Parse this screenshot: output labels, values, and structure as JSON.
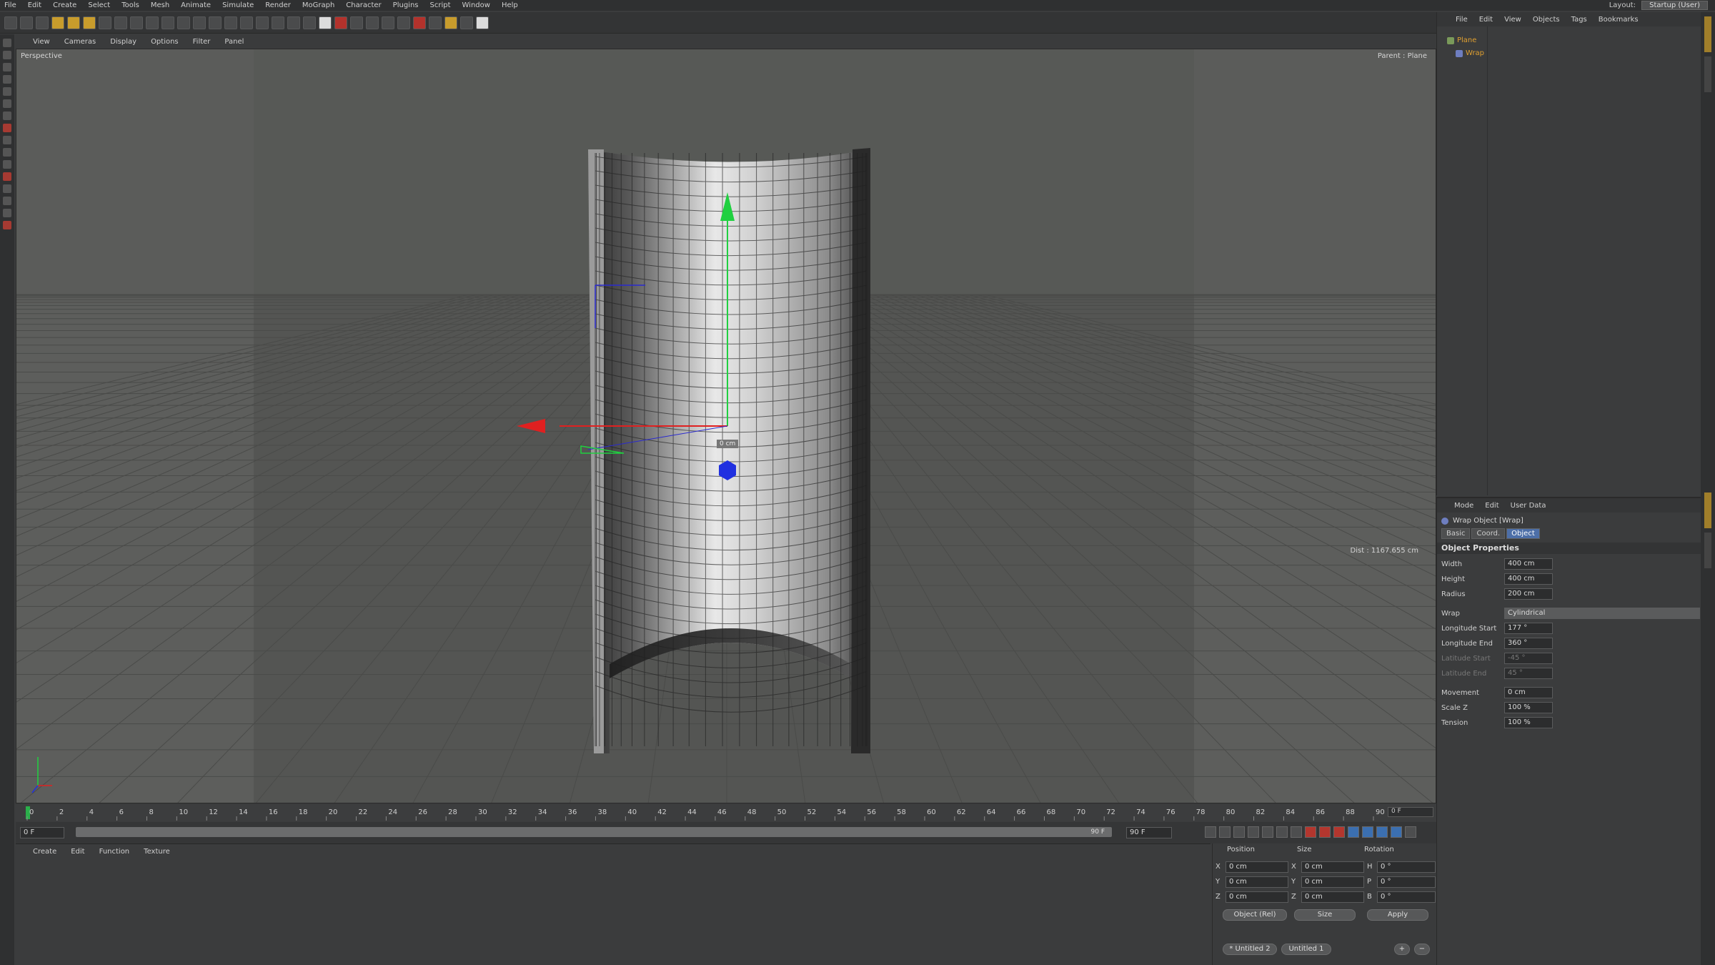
{
  "menubar": {
    "items": [
      "File",
      "Edit",
      "Create",
      "Select",
      "Tools",
      "Mesh",
      "Animate",
      "Simulate",
      "Render",
      "MoGraph",
      "Character",
      "Plugins",
      "Script",
      "Window",
      "Help"
    ],
    "layout_label": "Layout:",
    "layout_value": "Startup (User)"
  },
  "viewport": {
    "menu": [
      "View",
      "Cameras",
      "Display",
      "Options",
      "Filter",
      "Panel"
    ],
    "label": "Perspective",
    "parent_text": "Parent : Plane",
    "distance_text": "Dist : 1167.655 cm",
    "axis_readout": "0 cm"
  },
  "timeline": {
    "ticks": [
      "0",
      "2",
      "4",
      "6",
      "8",
      "10",
      "12",
      "14",
      "16",
      "18",
      "20",
      "22",
      "24",
      "26",
      "28",
      "30",
      "32",
      "34",
      "36",
      "38",
      "40",
      "42",
      "44",
      "46",
      "48",
      "50",
      "52",
      "54",
      "56",
      "58",
      "60",
      "62",
      "64",
      "66",
      "68",
      "70",
      "72",
      "74",
      "76",
      "78",
      "80",
      "82",
      "84",
      "86",
      "88",
      "90"
    ],
    "current_frame": "0 F",
    "end_field": "0 F",
    "start_field": "0 F",
    "range_end": "90 F",
    "max_field": "90 F"
  },
  "material_manager": {
    "menu": [
      "Create",
      "Edit",
      "Function",
      "Texture"
    ]
  },
  "coordinates": {
    "headers": [
      "Position",
      "Size",
      "Rotation"
    ],
    "rows": [
      {
        "axis": "X",
        "pos": "0 cm",
        "size_axis": "X",
        "size": "0 cm",
        "rot_axis": "H",
        "rot": "0 °"
      },
      {
        "axis": "Y",
        "pos": "0 cm",
        "size_axis": "Y",
        "size": "0 cm",
        "rot_axis": "P",
        "rot": "0 °"
      },
      {
        "axis": "Z",
        "pos": "0 cm",
        "size_axis": "Z",
        "size": "0 cm",
        "rot_axis": "B",
        "rot": "0 °"
      }
    ],
    "mode_select": "Object (Rel)",
    "size_select": "Size",
    "apply_label": "Apply",
    "tabs": [
      "* Untitled 2",
      "Untitled 1"
    ]
  },
  "object_manager": {
    "menu": [
      "File",
      "Edit",
      "View",
      "Objects",
      "Tags",
      "Bookmarks"
    ],
    "objects": [
      {
        "name": "Plane",
        "level": 0
      },
      {
        "name": "Wrap",
        "level": 1
      }
    ]
  },
  "attribute_manager": {
    "menu": [
      "Mode",
      "Edit",
      "User Data"
    ],
    "title": "Wrap Object [Wrap]",
    "tabs": [
      "Basic",
      "Coord.",
      "Object"
    ],
    "active_tab": "Object",
    "section": "Object Properties",
    "properties": [
      {
        "label": "Width",
        "value": "400 cm"
      },
      {
        "label": "Height",
        "value": "400 cm"
      },
      {
        "label": "Radius",
        "value": "200 cm"
      },
      {
        "label": "Wrap",
        "value": "Cylindrical"
      },
      {
        "label": "Longitude Start",
        "value": "177 °"
      },
      {
        "label": "Longitude End",
        "value": "360 °"
      },
      {
        "label": "Latitude Start",
        "value": "-45 °"
      },
      {
        "label": "Latitude End",
        "value": "45 °"
      },
      {
        "label": "Movement",
        "value": "0 cm"
      },
      {
        "label": "Scale Z",
        "value": "100 %"
      },
      {
        "label": "Tension",
        "value": "100 %"
      }
    ]
  },
  "colors": {
    "viewport_bg": "#545553",
    "active_tab": "#4d6fa8",
    "axis_x": "#e02020",
    "axis_y": "#20d040",
    "axis_z": "#2030e0",
    "object_name": "#e0a030"
  }
}
